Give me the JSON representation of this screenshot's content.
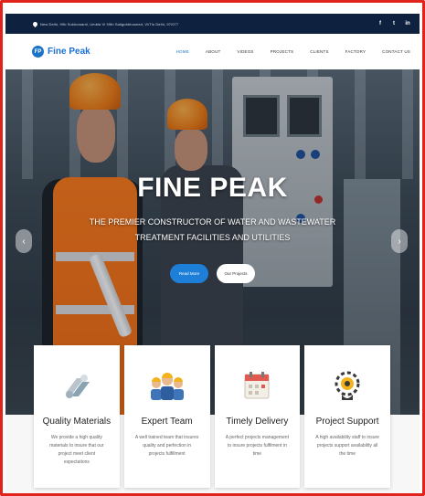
{
  "topbar": {
    "address": "New Delhi, 99b Sukhomanti, Umbla Vl 99th Sailgubbhoseed, Vl/Tin Delhi, 97/077",
    "social": [
      "f",
      "t",
      "in"
    ]
  },
  "brand": {
    "mark": "FP",
    "name": "Fine Peak"
  },
  "nav": {
    "items": [
      "HOME",
      "ABOUT",
      "VIDEOS",
      "PROJECTS",
      "CLIENTS",
      "FACTORY",
      "CONTACT US"
    ],
    "active_index": 0
  },
  "hero": {
    "title": "FINE PEAK",
    "subtitle_line1": "THE PREMIER CONSTRUCTOR OF WATER AND WASTEWATER",
    "subtitle_line2": "TREATMENT FACILITIES AND UTILITIES",
    "primary_button": "Read More",
    "secondary_button": "Our Projects",
    "prev_arrow": "‹",
    "next_arrow": "›"
  },
  "features": [
    {
      "icon": "pipe-icon",
      "title": "Quality Materials",
      "desc": "We provide a high quality materials to insure that our project meet client expectations"
    },
    {
      "icon": "team-icon",
      "title": "Expert Team",
      "desc": "A well trained team that insures quality and perfection in projects fulfillment"
    },
    {
      "icon": "calendar-icon",
      "title": "Timely Delivery",
      "desc": "A perfect projects management to insure projects fulfilment in time"
    },
    {
      "icon": "support-icon",
      "title": "Project Support",
      "desc": "A high availability staff to insure projects support availability all the time"
    }
  ],
  "colors": {
    "frame": "#e0241b",
    "topbar": "#0e2240",
    "accent": "#1e7fd8",
    "helmet": "#f07c12"
  }
}
